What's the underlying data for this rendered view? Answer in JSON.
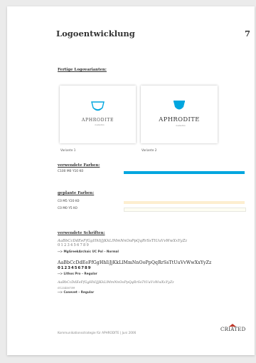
{
  "page": {
    "title": "Logoentwicklung",
    "number": "7"
  },
  "logo_section": {
    "heading": "Fertige Logovarianten:",
    "variants": [
      {
        "label": "Variante 1",
        "wordmark": "APHRODITE",
        "tagline": "kosmetics"
      },
      {
        "label": "Variante 2",
        "wordmark": "APHRODITE",
        "tagline": "kosmetics"
      }
    ]
  },
  "used_colors": {
    "heading": "verwendete Farben:",
    "items": [
      {
        "label": "C100 M0 Y10 K0",
        "color": "#00a6df"
      }
    ]
  },
  "planned_colors": {
    "heading": "geplante Farben:",
    "items": [
      {
        "label": "C0 M5 Y20 K0",
        "color": "#fdeecf"
      },
      {
        "label": "C0 M0 Y5 K0",
        "color": "#fdfdf3"
      }
    ]
  },
  "fonts": {
    "heading": "verwendete Schriften:",
    "items": [
      {
        "sample": "AaBbCcDdEeFfGgHhIiJjKkLlMmNnOoPpQqRrSsTtUuVvWwXxYyZz",
        "numbers": "0123456789",
        "name": "--> MgGreekArchaic UC Pol – Normal"
      },
      {
        "sample": "AaBbCcDdEeFfGgHhIiJjKkLlMmNnOoPpQqRrSsTtUuVvWwXxYyZz",
        "numbers": "0123456789",
        "name": "--> Lithos Pro – Regular"
      },
      {
        "sample": "AaBbCcDdEeFfGgHhIiJjKkLlMmNnOoPpQqRrSsTtUuVvWwXxYyZz",
        "numbers": "0123456789",
        "name": "--> Conevet – Regular"
      }
    ]
  },
  "footer": {
    "text": "Kommunikationsstrategie für APHRODITE   |   Juni 2006",
    "brand": "CRIATED",
    "brand_accent": "#c0392b"
  },
  "colors": {
    "accent": "#00a6df"
  }
}
